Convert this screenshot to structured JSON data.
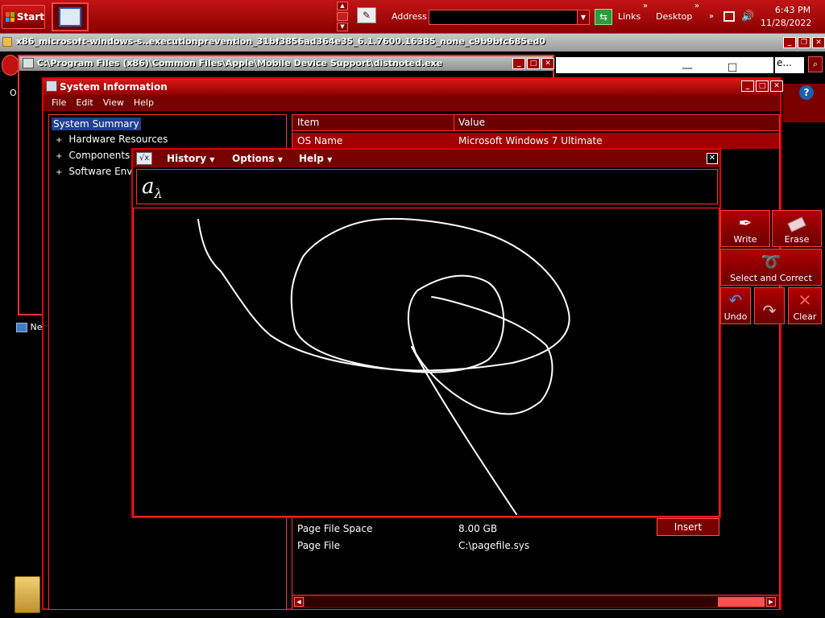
{
  "taskbar": {
    "start_label": "Start",
    "address_label": "Address",
    "address_value": "",
    "links_label": "Links",
    "desktop_label": "Desktop",
    "chevron": "»",
    "clock_time": "6:43 PM",
    "clock_date": "11/28/2022"
  },
  "background_windows": {
    "window1_title": "x86_microsoft-windows-s..executionprevention_31bf3856ad364e35_6.1.7600.16385_none_c9b9bfc685ed0",
    "window2_title": "C:\\Program Files (x86)\\Common Files\\Apple\\Mobile Device Support\\distnoted.exe",
    "edge_label": "O",
    "desktop_network_label": "Ne",
    "ie_search_text": "e..."
  },
  "system_info": {
    "title": "System Information",
    "menu": [
      "File",
      "Edit",
      "View",
      "Help"
    ],
    "tree": [
      {
        "label": "System Summary",
        "selected": true
      },
      {
        "label": "Hardware Resources",
        "expander": "+"
      },
      {
        "label": "Components",
        "expander": "+"
      },
      {
        "label": "Software Envi",
        "expander": "+"
      }
    ],
    "columns": {
      "item": "Item",
      "value": "Value"
    },
    "rows": [
      {
        "item": "OS Name",
        "value": "Microsoft Windows 7 Ultimate"
      },
      {
        "item": "Page File Space",
        "value": "8.00 GB"
      },
      {
        "item": "Page File",
        "value": "C:\\pagefile.sys"
      }
    ]
  },
  "math_input": {
    "menu": [
      "History",
      "Options",
      "Help"
    ],
    "preview_main": "a",
    "preview_sub": "λ",
    "insert_label": "Insert",
    "tools": {
      "write": "Write",
      "erase": "Erase",
      "select_correct": "Select and Correct",
      "undo": "Undo",
      "redo": "",
      "clear": "Clear"
    }
  },
  "colors": {
    "accent": "#e00000",
    "selection": "#1f3f90",
    "background": "#000000"
  }
}
